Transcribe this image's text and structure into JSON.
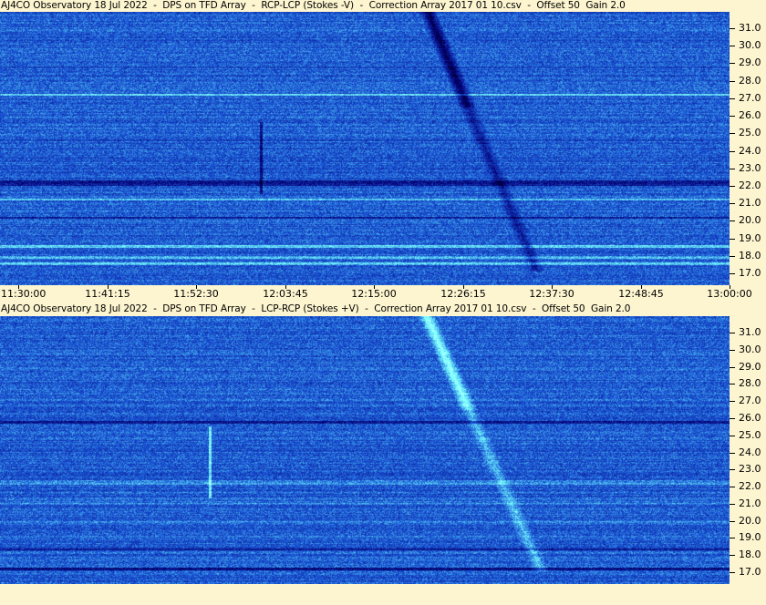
{
  "panels": [
    {
      "title": "AJ4CO Observatory 18 Jul 2022  -  DPS on TFD Array  -  RCP-LCP (Stokes -V)  -  Correction Array 2017 01 10.csv  -  Offset 50  Gain 2.0",
      "polarity": "RCP-LCP",
      "frequency_labels": [
        "31.0",
        "30.0",
        "29.0",
        "28.0",
        "27.0",
        "26.0",
        "25.0",
        "24.0",
        "23.0",
        "22.0",
        "21.0",
        "20.0",
        "19.0",
        "18.0",
        "17.0"
      ]
    },
    {
      "title": "AJ4CO Observatory 18 Jul 2022  -  DPS on TFD Array  -  LCP-RCP (Stokes +V)  -  Correction Array 2017 01 10.csv  -  Offset 50  Gain 2.0",
      "polarity": "LCP-RCP",
      "frequency_labels": [
        "31.0",
        "30.0",
        "29.0",
        "28.0",
        "27.0",
        "26.0",
        "25.0",
        "24.0",
        "23.0",
        "22.0",
        "21.0",
        "20.0",
        "19.0",
        "18.0",
        "17.0"
      ]
    }
  ],
  "time_axis": {
    "labels": [
      "11:30:00",
      "11:41:15",
      "11:52:30",
      "12:03:45",
      "12:15:00",
      "12:26:15",
      "12:37:30",
      "12:48:45",
      "13:00:00"
    ]
  },
  "colors": {
    "background": "#fdf5d0",
    "spectrogram_base": "#1f57d8",
    "dark_band": "#0b2a8a",
    "bright_band": "#7fe8ff",
    "highlight": "#f4ff9a"
  }
}
